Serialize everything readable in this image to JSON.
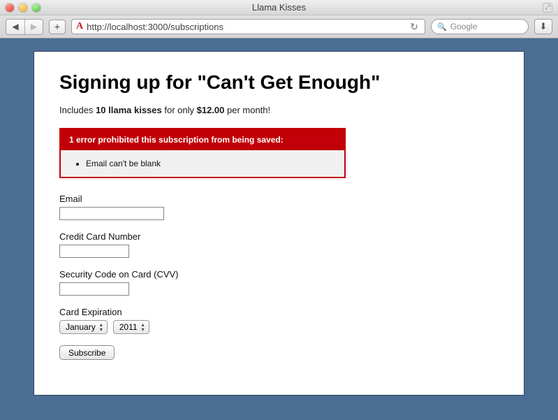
{
  "window": {
    "title": "Llama Kisses",
    "url": "http://localhost:3000/subscriptions",
    "search_placeholder": "Google"
  },
  "page": {
    "heading": "Signing up for \"Can't Get Enough\"",
    "desc_prefix": "Includes ",
    "desc_kisses": "10 llama kisses",
    "desc_mid": " for only ",
    "desc_price": "$12.00",
    "desc_suffix": " per month!"
  },
  "error": {
    "heading": "1 error prohibited this subscription from being saved:",
    "items": [
      "Email can't be blank"
    ]
  },
  "form": {
    "email_label": "Email",
    "email_value": "",
    "cc_label": "Credit Card Number",
    "cc_value": "",
    "cvv_label": "Security Code on Card (CVV)",
    "cvv_value": "",
    "exp_label": "Card Expiration",
    "month_selected": "January",
    "year_selected": "2011",
    "submit_label": "Subscribe"
  }
}
